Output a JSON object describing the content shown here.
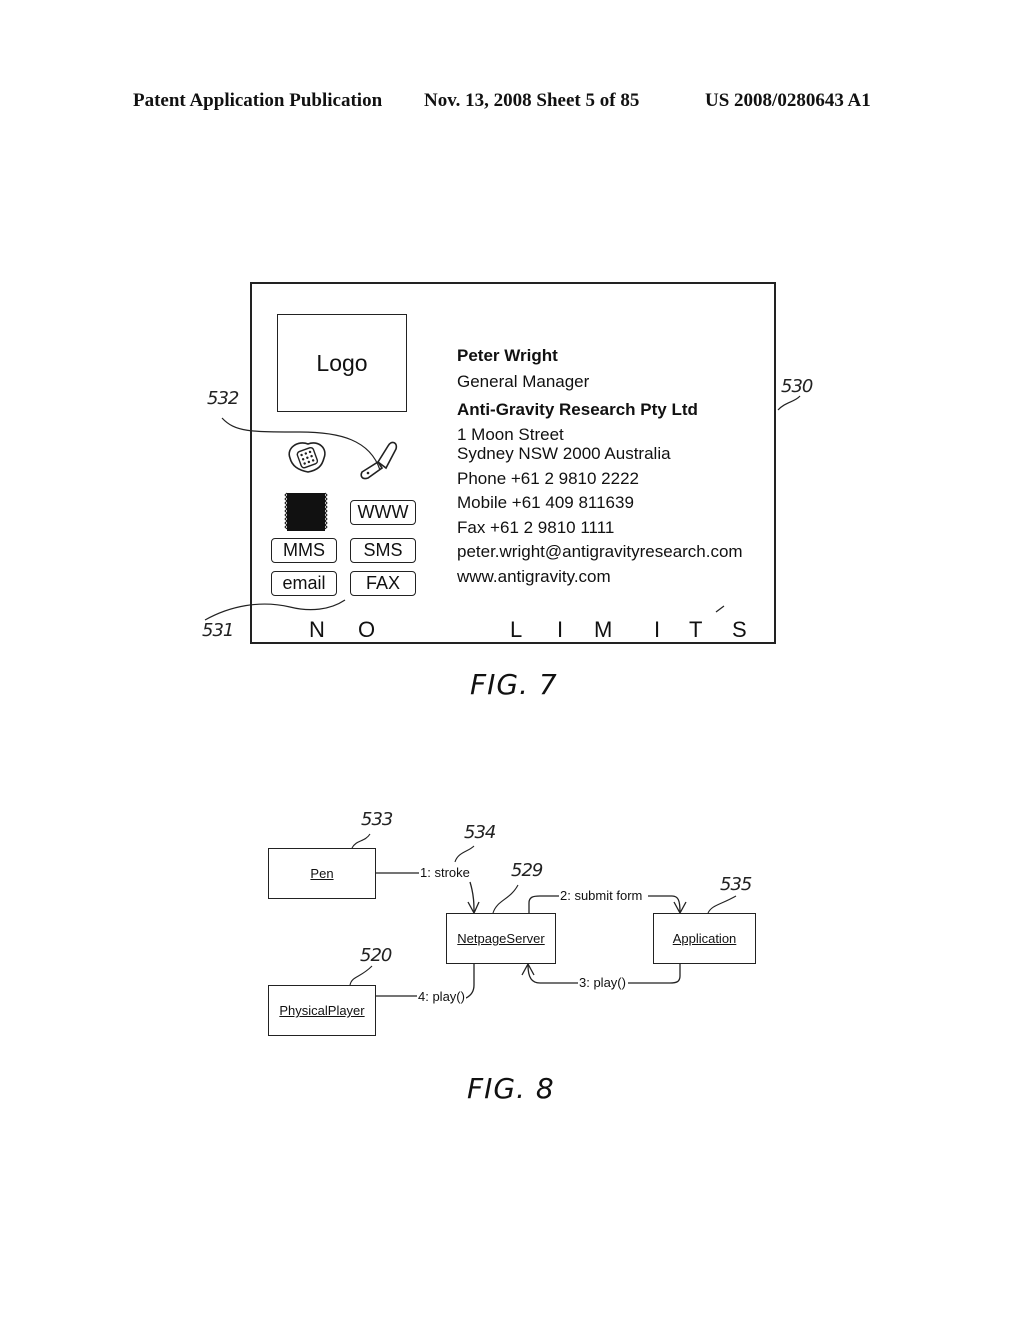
{
  "header": {
    "left": "Patent Application Publication",
    "date_sheet": "Nov. 13, 2008  Sheet 5 of 85",
    "pub_number": "US 2008/0280643 A1"
  },
  "fig7": {
    "label": "FIG. 7",
    "refs": {
      "card": "530",
      "icons": "532",
      "tagline": "531"
    },
    "logo": "Logo",
    "icons": [
      "phone-icon",
      "mobile-phone-icon",
      "barcode-icon"
    ],
    "buttons": {
      "www": "WWW",
      "mms": "MMS",
      "sms": "SMS",
      "email": "email",
      "fax": "FAX"
    },
    "contact": {
      "name": "Peter Wright",
      "title": "General Manager",
      "company": "Anti-Gravity Research Pty Ltd",
      "address1": "1 Moon Street",
      "address2": "Sydney NSW 2000 Australia",
      "phone": "Phone +61 2 9810 2222",
      "mobile": "Mobile +61 409 811639",
      "fax": "Fax +61 2 9810 1111",
      "email": "peter.wright@antigravityresearch.com",
      "web": "www.antigravity.com"
    },
    "tagline_letters": [
      "N",
      "O",
      "L",
      "I",
      "M",
      "I",
      "T",
      "S"
    ]
  },
  "fig8": {
    "label": "FIG. 8",
    "objects": {
      "pen": {
        "name": "Pen",
        "ref": "533"
      },
      "server": {
        "name": "NetpageServer",
        "ref": "529"
      },
      "application": {
        "name": "Application",
        "ref": "535"
      },
      "player": {
        "name": "PhysicalPlayer",
        "ref": "520"
      }
    },
    "messages": {
      "m1": "1: stroke",
      "m1_ref": "534",
      "m2": "2: submit form",
      "m3": "3: play()",
      "m4": "4: play()"
    }
  }
}
